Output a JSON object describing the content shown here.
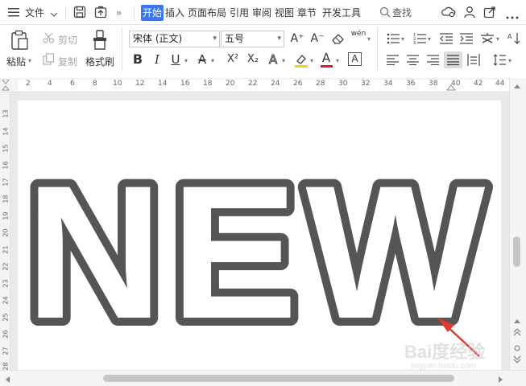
{
  "menubar": {
    "file_menu": "文件",
    "tabs": [
      {
        "label": "开始",
        "active": true
      },
      {
        "label": "插入",
        "active": false
      },
      {
        "label": "页面布局",
        "active": false
      },
      {
        "label": "引用",
        "active": false
      },
      {
        "label": "审阅",
        "active": false
      },
      {
        "label": "视图",
        "active": false
      },
      {
        "label": "章节",
        "active": false
      },
      {
        "label": "开发工具",
        "active": false
      }
    ],
    "search_label": "查找",
    "accent_color": "#3a78f2"
  },
  "ribbon": {
    "paste_label": "粘贴",
    "cut_label": "剪切",
    "copy_label": "复制",
    "format_painter_label": "格式刷",
    "font_name": "宋体 (正文)",
    "font_size": "五号",
    "bold_label": "B",
    "italic_label": "I",
    "underline_label": "U",
    "strikethrough_label": "A",
    "superscript_label": "X²",
    "subscript_label": "X₂",
    "text_effect_label": "A",
    "font_color_label": "A",
    "char_border_label": "A",
    "grow_font_label": "A⁺",
    "shrink_font_label": "A⁻",
    "phonetic_label": "wén",
    "font_color_hex": "#d42020",
    "highlight_color_hex": "#f2d21b"
  },
  "ruler": {
    "h_numbers": [
      "2",
      "4",
      "6",
      "8",
      "10",
      "12",
      "14",
      "16",
      "18",
      "20",
      "22",
      "24",
      "26",
      "28",
      "30",
      "32",
      "34",
      "36",
      "38",
      "40",
      "42",
      "44"
    ],
    "v_numbers": [
      "13",
      "14",
      "15",
      "16",
      "17",
      "18",
      "19",
      "20",
      "21",
      "22",
      "23",
      "24",
      "25",
      "26",
      "27",
      "28"
    ]
  },
  "document": {
    "wordart_text": "NEW",
    "outline_color": "#555555",
    "arrow_color": "#e03a2e"
  },
  "watermark": {
    "line1": "Bai度经验",
    "line2": "jingyan.baidu.com"
  }
}
